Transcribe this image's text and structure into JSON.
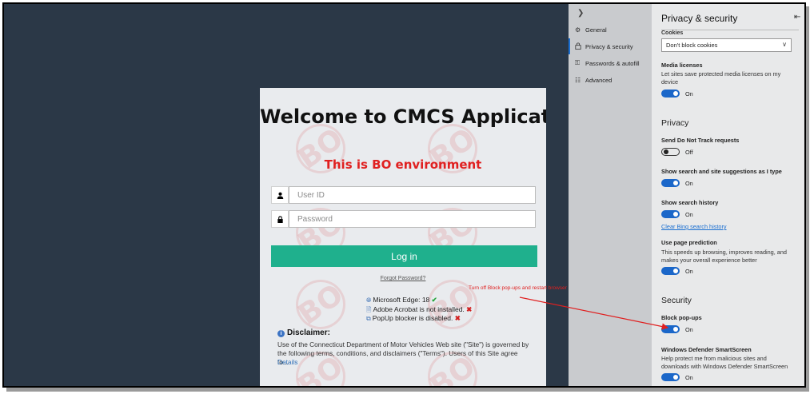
{
  "login": {
    "title": "Welcome to CMCS Application",
    "environment": "This is BO environment",
    "watermark": "BO",
    "userid_placeholder": "User ID",
    "password_placeholder": "Password",
    "login_label": "Log in",
    "forgot_label": "Forgot Password?",
    "checks": {
      "edge": "Microsoft Edge: 18",
      "acrobat": "Adobe Acrobat is not installed.",
      "popup": "PopUp blocker is disabled."
    },
    "disclaimer_title": "Disclaimer:",
    "disclaimer_text": "Use of the Connecticut Department of Motor Vehicles Web site (\"Site\") is governed by the following terms, conditions, and disclaimers (\"Terms\"). Users of this Site agree to...",
    "details_label": "Details"
  },
  "settings_nav": {
    "items": [
      {
        "label": "General",
        "icon": "gear-icon"
      },
      {
        "label": "Privacy & security",
        "icon": "lock-icon"
      },
      {
        "label": "Passwords & autofill",
        "icon": "key-icon"
      },
      {
        "label": "Advanced",
        "icon": "sliders-icon"
      }
    ]
  },
  "settings": {
    "title": "Privacy & security",
    "cookies_label": "Cookies",
    "cookies_value": "Don't block cookies",
    "media_licenses_label": "Media licenses",
    "media_licenses_desc": "Let sites save protected media licenses on my device",
    "media_licenses_state": "On",
    "privacy_section": "Privacy",
    "dnt_label": "Send Do Not Track requests",
    "dnt_state": "Off",
    "suggestions_label": "Show search and site suggestions as I type",
    "suggestions_state": "On",
    "history_label": "Show search history",
    "history_state": "On",
    "clear_history_link": "Clear Bing search history",
    "prediction_label": "Use page prediction",
    "prediction_desc": "This speeds up browsing, improves reading, and makes your overall experience better",
    "prediction_state": "On",
    "security_section": "Security",
    "popups_label": "Block pop-ups",
    "popups_state": "On",
    "smartscreen_label": "Windows Defender SmartScreen",
    "smartscreen_desc": "Help protect me from malicious sites and downloads with Windows Defender SmartScreen",
    "smartscreen_state": "On"
  },
  "annotation": {
    "text": "Turn off Block pop-ups and restart browser",
    "color": "#e02020"
  }
}
